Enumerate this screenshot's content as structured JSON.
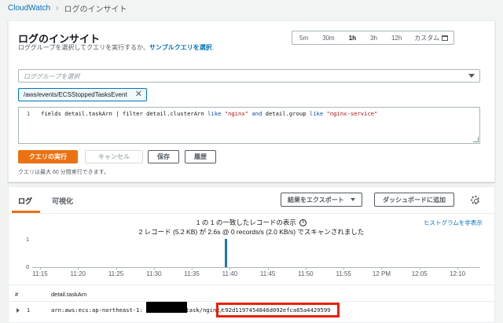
{
  "breadcrumb": {
    "root": "CloudWatch",
    "current": "ログのインサイト"
  },
  "header": {
    "title": "ログのインサイト",
    "description": "ロググループを選択してクエリを実行するか、",
    "sample_link": "サンプルクエリを選択",
    "sample_suffix": "."
  },
  "time_range": {
    "options": [
      "5m",
      "30m",
      "1h",
      "3h",
      "12h"
    ],
    "selected": "1h",
    "custom_label": "カスタム"
  },
  "log_group_select": {
    "placeholder": "ロググループを選択"
  },
  "selected_log_group": "/aws/events/ECSStoppedTasksEvent",
  "query_editor": {
    "line_number": "1",
    "segments": [
      {
        "t": "fields detail.taskArn | filter detail.clusterArn ",
        "c": ""
      },
      {
        "t": "like",
        "c": "kw"
      },
      {
        "t": " ",
        "c": ""
      },
      {
        "t": "\"nginx\"",
        "c": "str"
      },
      {
        "t": " ",
        "c": ""
      },
      {
        "t": "and",
        "c": "kw"
      },
      {
        "t": " detail.group ",
        "c": ""
      },
      {
        "t": "like",
        "c": "kw"
      },
      {
        "t": " ",
        "c": ""
      },
      {
        "t": "\"nginx-service\"",
        "c": "str"
      }
    ]
  },
  "actions": {
    "run": "クエリの実行",
    "cancel": "キャンセル",
    "save": "保存",
    "history": "履歴"
  },
  "hint": "クエリは最大 60 分間実行できます。",
  "results": {
    "tabs": {
      "logs": "ログ",
      "visualize": "可視化"
    },
    "export_button": "結果をエクスポート",
    "dashboard_button": "ダッシュボードに追加",
    "summary_line1": "1 の 1 の一致したレコードの表示",
    "info_glyph": "i",
    "summary_line2": "2 レコード (5.2 KB) が 2.6s @ 0 records/s (2.0 KB/s) でスキャンされました",
    "hide_histogram": "ヒストグラムを非表示",
    "columns": {
      "index": "#",
      "field": "detail.taskArn"
    },
    "rows": [
      {
        "index": "1",
        "prefix": "arn:aws:ecs:ap-northeast-1:",
        "middle": ":task/nginx/",
        "task_id": "c92d1197454846d092efca65a4429599"
      }
    ]
  },
  "chart_data": {
    "type": "bar",
    "categories": [
      "11:15",
      "11:20",
      "11:25",
      "11:30",
      "11:35",
      "11:40",
      "11:45",
      "11:50",
      "11:55",
      "12 PM",
      "12:05",
      "12:10"
    ],
    "x_ticks": [
      "11:15",
      "11:20",
      "11:25",
      "11:30",
      "11:35",
      "11:40",
      "11:45",
      "11:50",
      "11:55",
      "12 PM",
      "12:05",
      "12:10"
    ],
    "bars": [
      {
        "x_minutes_after_start": 24.5,
        "value": 1
      }
    ],
    "y_ticks": [
      "1",
      "0"
    ],
    "ylim": [
      0,
      1
    ],
    "color": "#1f77b4"
  },
  "colors": {
    "primary": "#ec7211",
    "link": "#0073bb",
    "highlight": "#e8200a"
  }
}
